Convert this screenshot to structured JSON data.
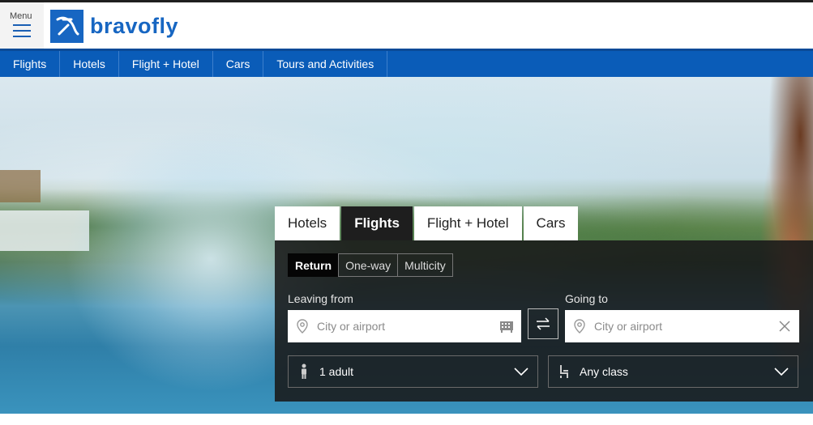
{
  "header": {
    "menu_label": "Menu",
    "brand": "bravofly"
  },
  "nav": {
    "items": [
      "Flights",
      "Hotels",
      "Flight + Hotel",
      "Cars",
      "Tours and Activities"
    ]
  },
  "search": {
    "tabs": [
      "Hotels",
      "Flights",
      "Flight + Hotel",
      "Cars"
    ],
    "active_tab": "Flights",
    "trip_types": [
      "Return",
      "One-way",
      "Multicity"
    ],
    "active_trip_type": "Return",
    "leaving_label": "Leaving from",
    "leaving_placeholder": "City or airport",
    "going_label": "Going to",
    "going_placeholder": "City or airport",
    "passengers_value": "1 adult",
    "class_value": "Any class"
  },
  "colors": {
    "brand_blue": "#1766c2",
    "nav_blue": "#0a5cb8",
    "panel_dark": "#1e1e1e"
  }
}
